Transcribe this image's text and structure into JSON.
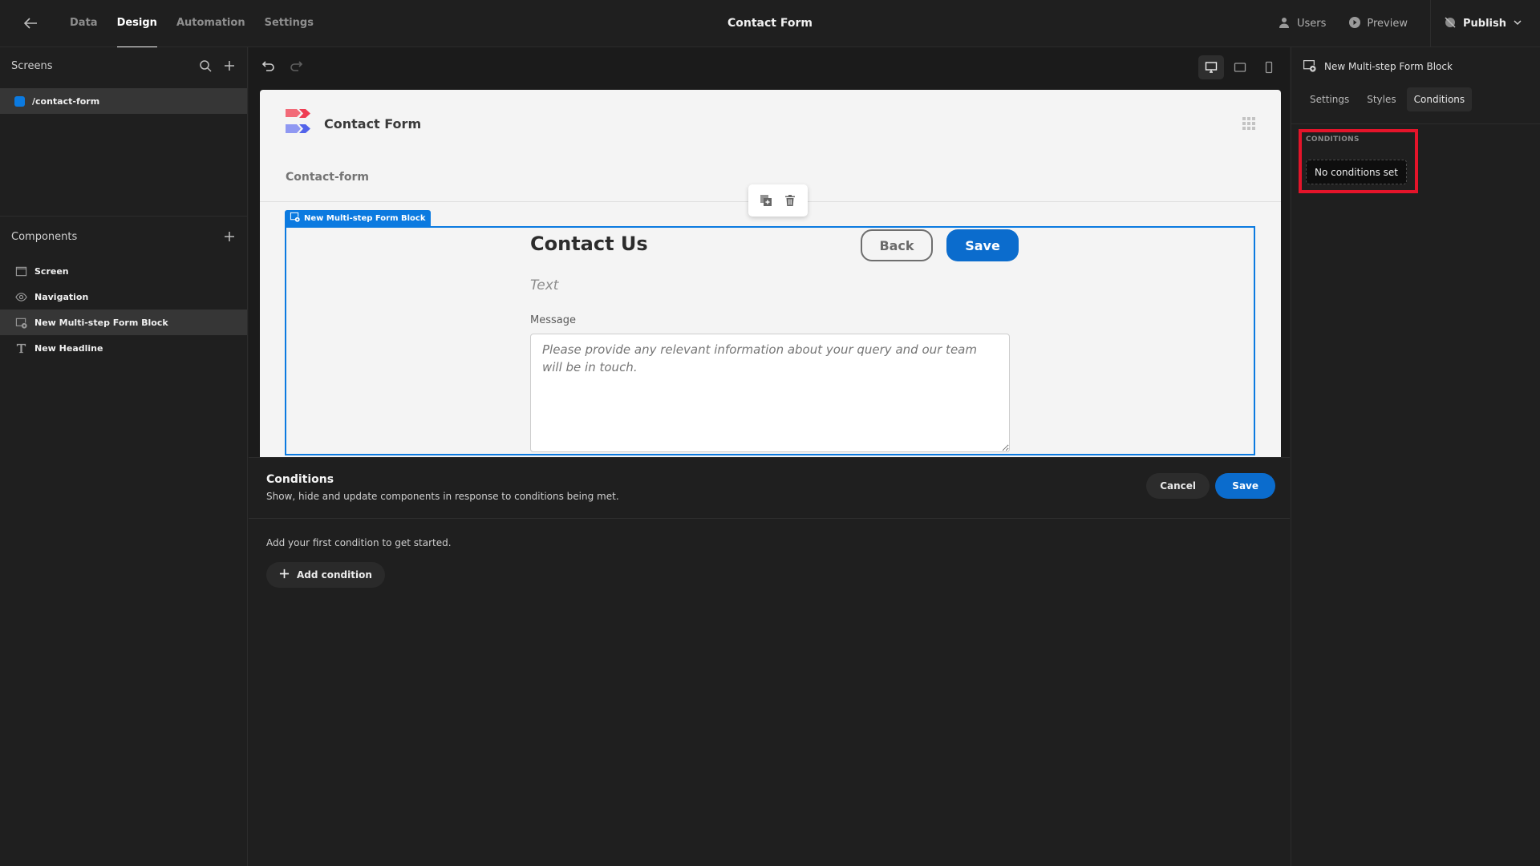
{
  "topbar": {
    "tabs": [
      {
        "label": "Data",
        "active": false
      },
      {
        "label": "Design",
        "active": true
      },
      {
        "label": "Automation",
        "active": false
      },
      {
        "label": "Settings",
        "active": false
      }
    ],
    "title": "Contact Form",
    "users_label": "Users",
    "preview_label": "Preview",
    "publish_label": "Publish"
  },
  "left": {
    "screens_header": "Screens",
    "screens": [
      {
        "label": "/contact-form",
        "color": "#0b7ae0"
      }
    ],
    "components_header": "Components",
    "components": [
      {
        "label": "Screen",
        "icon": "screen-icon",
        "selected": false
      },
      {
        "label": "Navigation",
        "icon": "eye-icon",
        "selected": false
      },
      {
        "label": "New Multi-step Form Block",
        "icon": "form-block-icon",
        "selected": true
      },
      {
        "label": "New Headline",
        "icon": "text-icon",
        "selected": false
      }
    ]
  },
  "preview": {
    "app_title": "Contact Form",
    "nav_link": "Contact-form",
    "block_tag": "New Multi-step Form Block",
    "form_title": "Contact Us",
    "back_label": "Back",
    "save_label": "Save",
    "text_placeholder": "Text",
    "message_label": "Message",
    "message_placeholder": "Please provide any relevant information about your query and our team will be in touch."
  },
  "conditions_panel": {
    "title": "Conditions",
    "subtitle": "Show, hide and update components in response to conditions being met.",
    "cancel_label": "Cancel",
    "save_label": "Save",
    "empty_text": "Add your first condition to get started.",
    "add_label": "Add condition"
  },
  "right_panel": {
    "component_name": "New Multi-step Form Block",
    "tabs": [
      {
        "label": "Settings",
        "active": false
      },
      {
        "label": "Styles",
        "active": false
      },
      {
        "label": "Conditions",
        "active": true
      }
    ],
    "conditions_label": "CONDITIONS",
    "no_conditions": "No conditions set",
    "highlight_color": "#e4142a"
  },
  "colors": {
    "accent": "#0b6ccd",
    "selection": "#0b7ae0"
  }
}
